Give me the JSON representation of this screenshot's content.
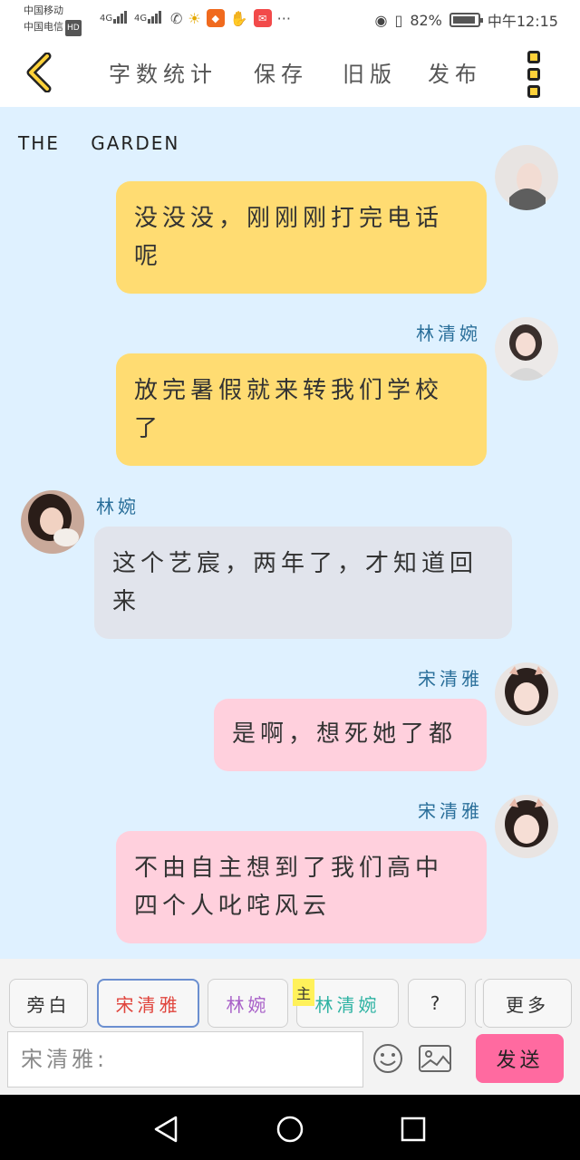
{
  "status_bar": {
    "carrier_1": "中国移动",
    "carrier_2": "中国电信",
    "hd": "HD",
    "net_1": "4G",
    "net_2": "4G",
    "battery": "82%",
    "time": "中午12:15",
    "dots": "···"
  },
  "toolbar": {
    "word_count": "字数统计",
    "save": "保存",
    "old_version": "旧版",
    "publish": "发布",
    "accent": "#ffd23a"
  },
  "chat": {
    "title": "THE GARDEN",
    "messages": [
      {
        "sender": "",
        "text": "没没没，刚刚刚打完电话呢"
      },
      {
        "sender": "林清婉",
        "text": "放完暑假就来转我们学校了"
      },
      {
        "sender": "林婉",
        "text": "这个艺宸，两年了，才知道回来"
      },
      {
        "sender": "宋清雅",
        "text": "是啊，想死她了都"
      },
      {
        "sender": "宋清雅",
        "text": "不由自主想到了我们高中四个人叱咤风云"
      }
    ]
  },
  "roles": {
    "narration": "旁白",
    "role_1": "宋清雅",
    "role_2": "林婉",
    "role_3": "林清婉",
    "main_badge": "主",
    "unknown": "?",
    "more": "更多"
  },
  "composer": {
    "placeholder": "宋清雅:",
    "send": "发送",
    "send_color": "#ff6aa0"
  },
  "icons": {
    "back": "chevron-left-icon",
    "menu": "more-vertical-icon",
    "emoji": "emoji-icon",
    "image": "image-icon",
    "nav_back": "triangle-back-icon",
    "nav_home": "circle-home-icon",
    "nav_recent": "square-recent-icon"
  }
}
